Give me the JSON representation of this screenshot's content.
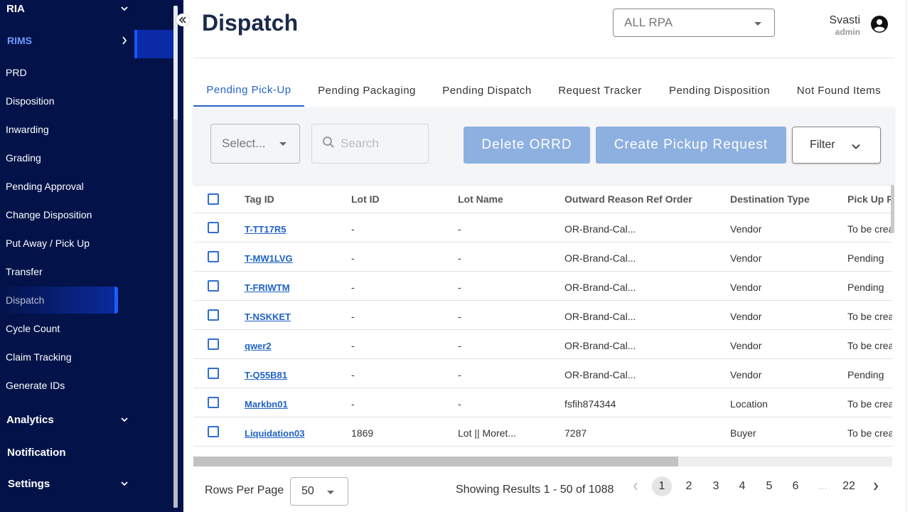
{
  "sidebar": {
    "items": [
      {
        "label": "RIA",
        "kind": "group"
      },
      {
        "label": "RIMS",
        "kind": "active-group"
      },
      {
        "label": "PRD"
      },
      {
        "label": "Disposition"
      },
      {
        "label": "Inwarding"
      },
      {
        "label": "Grading"
      },
      {
        "label": "Pending Approval"
      },
      {
        "label": "Change Disposition"
      },
      {
        "label": "Put Away / Pick Up"
      },
      {
        "label": "Transfer"
      },
      {
        "label": "Dispatch",
        "active": true
      },
      {
        "label": "Cycle Count"
      },
      {
        "label": "Claim Tracking"
      },
      {
        "label": "Generate IDs"
      },
      {
        "label": "Analytics",
        "kind": "group"
      },
      {
        "label": "Notification",
        "kind": "group"
      },
      {
        "label": "Settings",
        "kind": "group"
      }
    ],
    "collapse_icon": "double-chevron-left-icon"
  },
  "header": {
    "title": "Dispatch",
    "rpa_select": {
      "value": "ALL RPA"
    },
    "user": {
      "name": "Svasti",
      "role": "admin",
      "icon": "account-circle-icon"
    }
  },
  "tabs": [
    {
      "label": "Pending Pick-Up",
      "active": true
    },
    {
      "label": "Pending Packaging"
    },
    {
      "label": "Pending Dispatch"
    },
    {
      "label": "Request Tracker"
    },
    {
      "label": "Pending Disposition"
    },
    {
      "label": "Not Found Items"
    }
  ],
  "toolbar": {
    "select_placeholder": "Select...",
    "search_placeholder": "Search",
    "delete_label": "Delete ORRD",
    "create_label": "Create Pickup Request",
    "filter_label": "Filter"
  },
  "table": {
    "columns": [
      "Tag ID",
      "Lot ID",
      "Lot Name",
      "Outward Reason Ref Order",
      "Destination Type",
      "Pick Up R"
    ],
    "rows": [
      {
        "tag": "T-TT17R5",
        "lot_id": "-",
        "lot_name": "-",
        "orro": "OR-Brand-Cal...",
        "dest": "Vendor",
        "pickup": "To be crea"
      },
      {
        "tag": "T-MW1LVG",
        "lot_id": "-",
        "lot_name": "-",
        "orro": "OR-Brand-Cal...",
        "dest": "Vendor",
        "pickup": "Pending"
      },
      {
        "tag": "T-FRIWTM",
        "lot_id": "-",
        "lot_name": "-",
        "orro": "OR-Brand-Cal...",
        "dest": "Vendor",
        "pickup": "Pending"
      },
      {
        "tag": "T-NSKKET",
        "lot_id": "-",
        "lot_name": "-",
        "orro": "OR-Brand-Cal...",
        "dest": "Vendor",
        "pickup": "To be crea"
      },
      {
        "tag": "qwer2",
        "lot_id": "-",
        "lot_name": "-",
        "orro": "OR-Brand-Cal...",
        "dest": "Vendor",
        "pickup": "To be crea"
      },
      {
        "tag": "T-Q55B81",
        "lot_id": "-",
        "lot_name": "-",
        "orro": "OR-Brand-Cal...",
        "dest": "Vendor",
        "pickup": "Pending"
      },
      {
        "tag": "Markbn01",
        "lot_id": "-",
        "lot_name": "-",
        "orro": "fsfih874344",
        "dest": "Location",
        "pickup": "To be crea"
      },
      {
        "tag": "Liquidation03",
        "lot_id": "1869",
        "lot_name": "Lot || Moret...",
        "orro": "7287",
        "dest": "Buyer",
        "pickup": "To be crea"
      }
    ]
  },
  "footer": {
    "rows_per_page_label": "Rows Per Page",
    "rows_per_page_value": "50",
    "showing": "Showing Results 1 - 50 of 1088",
    "pages": [
      "1",
      "2",
      "3",
      "4",
      "5",
      "6",
      "...",
      "22"
    ],
    "current_page": "1"
  },
  "colors": {
    "sidebar_bg": "#03134a",
    "accent": "#2764c7",
    "button_disabled": "#8db0e0"
  }
}
